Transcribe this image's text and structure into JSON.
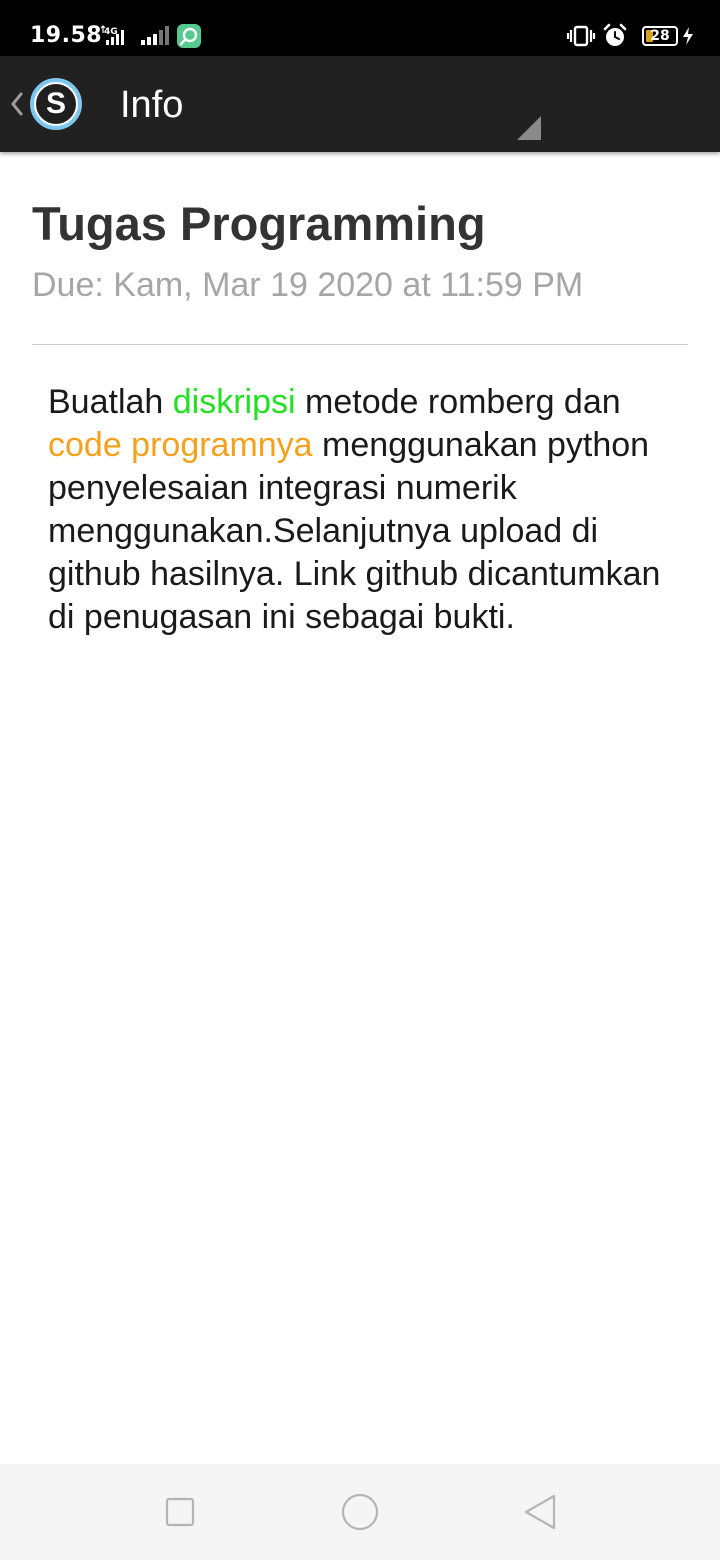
{
  "status_bar": {
    "time": "19.58",
    "network": "4G",
    "battery_level": "28",
    "icons": [
      "network-4g-icon",
      "signal-icon",
      "signal-icon-2",
      "app-notification-icon",
      "vibrate-icon",
      "alarm-icon",
      "battery-icon",
      "charging-icon"
    ]
  },
  "app_bar": {
    "logo_letter": "S",
    "title": "Info",
    "icons": [
      "back-chevron-icon",
      "overflow-triangle-icon"
    ]
  },
  "assignment": {
    "title": "Tugas Programming",
    "due": "Due:  Kam, Mar 19 2020 at 11:59 PM",
    "description": {
      "part1": "Buatlah ",
      "highlight1": "diskripsi",
      "part2": " metode romberg dan ",
      "highlight2": "code programnya",
      "part3": " menggunakan python penyelesaian integrasi numerik menggunakan.Selanjutnya upload di github hasilnya. Link github dicantumkan di penugasan ini sebagai bukti."
    }
  },
  "colors": {
    "status_bar": "#000000",
    "app_bar": "#212121",
    "logo_ring": "#7fc6ee",
    "highlight_green": "#22e022",
    "highlight_orange": "#f5a11c",
    "title_text": "#333333",
    "due_text": "#a6a6a6",
    "nav_bar": "#f5f5f5"
  },
  "nav_bar": {
    "buttons": [
      "recent-apps-icon",
      "home-icon",
      "back-icon"
    ]
  }
}
